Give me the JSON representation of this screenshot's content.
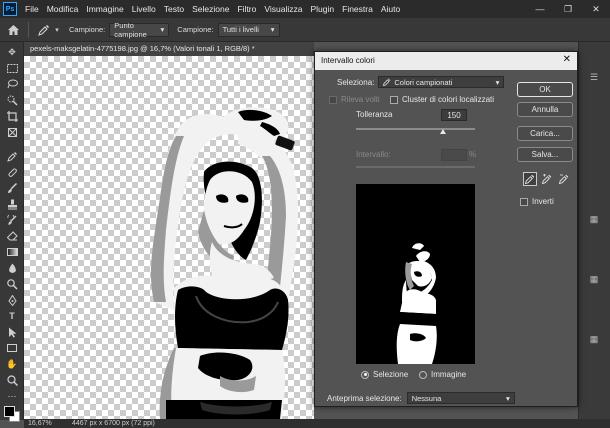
{
  "menubar": {
    "items": [
      "File",
      "Modifica",
      "Immagine",
      "Livello",
      "Testo",
      "Selezione",
      "Filtro",
      "Visualizza",
      "Plugin",
      "Finestra",
      "Aiuto"
    ],
    "app_logo": "Ps"
  },
  "options_bar": {
    "sample_label": "Campione:",
    "sample_value": "Punto campione",
    "sample2_label": "Campione:",
    "sample2_value": "Tutti i livelli"
  },
  "document": {
    "tab_title": "pexels-maksgelatin-4775198.jpg @ 16,7% (Valori tonali 1, RGB/8) *"
  },
  "status_bar": {
    "zoom": "16,67%",
    "info": "4467 px x 6700 px (72 ppi)"
  },
  "dialog": {
    "title": "Intervallo colori",
    "select_label": "Seleziona:",
    "select_value": "Colori campionati",
    "detect_faces_label": "Rileva volti",
    "localized_clusters_label": "Cluster di colori localizzati",
    "tolerance_label": "Tolleranza",
    "tolerance_value": "150",
    "range_label": "Intervallo:",
    "range_unit": "%",
    "ok_label": "OK",
    "cancel_label": "Annulla",
    "load_label": "Carica...",
    "save_label": "Salva...",
    "invert_label": "Inverti",
    "radio_selection_label": "Selezione",
    "radio_image_label": "Immagine",
    "preview_selection_label": "Anteprima selezione:",
    "preview_selection_value": "Nessuna"
  }
}
